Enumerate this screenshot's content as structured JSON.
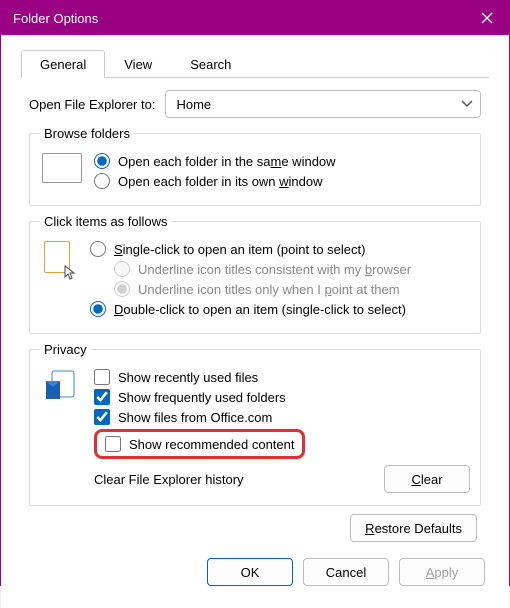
{
  "window": {
    "title": "Folder Options"
  },
  "tabs": [
    {
      "id": "general",
      "label": "General",
      "active": true
    },
    {
      "id": "view",
      "label": "View",
      "active": false
    },
    {
      "id": "search",
      "label": "Search",
      "active": false
    }
  ],
  "open_explorer": {
    "label": "Open File Explorer to:",
    "value": "Home"
  },
  "browse_folders": {
    "legend": "Browse folders",
    "same_window": "Open each folder in the same window",
    "own_window": "Open each folder in its own window",
    "selected": "same"
  },
  "click_items": {
    "legend": "Click items as follows",
    "single": "Single-click to open an item (point to select)",
    "underline_browser": "Underline icon titles consistent with my browser",
    "underline_point": "Underline icon titles only when I point at them",
    "double": "Double-click to open an item (single-click to select)",
    "selected": "double"
  },
  "privacy": {
    "legend": "Privacy",
    "recent_files": {
      "label": "Show recently used files",
      "checked": false
    },
    "frequent_folders": {
      "label": "Show frequently used folders",
      "checked": true
    },
    "office_files": {
      "label": "Show files from Office.com",
      "checked": true
    },
    "recommended": {
      "label": "Show recommended content",
      "checked": false
    },
    "clear_label": "Clear File Explorer history",
    "clear_button": "Clear"
  },
  "restore_defaults": "Restore Defaults",
  "footer": {
    "ok": "OK",
    "cancel": "Cancel",
    "apply": "Apply"
  }
}
